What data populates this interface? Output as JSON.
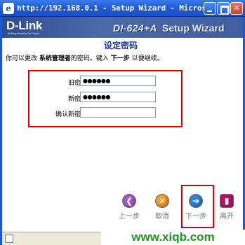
{
  "window": {
    "title": "http://192.168.0.1 - Setup Wizard - Micros..."
  },
  "banner": {
    "logo": "D-Link",
    "logo_tagline": "Building Networks for People",
    "model": "DI-624+A",
    "subtitle": "Setup Wizard"
  },
  "page": {
    "heading": "设定密码",
    "intro_prefix": "你可以更改",
    "intro_bold1": "系统管理者",
    "intro_middle": "的密码。键入",
    "intro_bold2": "下一步",
    "intro_suffix": "以便继续。"
  },
  "form": {
    "old_password_label": "旧密码",
    "old_password_value": "●●●●●●",
    "new_password_label": "新密码",
    "new_password_value": "●●●●●●",
    "confirm_password_label": "确认新密码",
    "confirm_password_value": ""
  },
  "nav": {
    "back_label": "上一步",
    "cancel_label": "取消",
    "next_label": "下一步",
    "exit_label": "离开"
  },
  "watermark": "www.xiqb.com",
  "colors": {
    "back": "#a25bc1",
    "cancel": "#f39a2a",
    "next": "#2f7fd6",
    "exit": "#b0156a",
    "highlight": "#e00000"
  }
}
